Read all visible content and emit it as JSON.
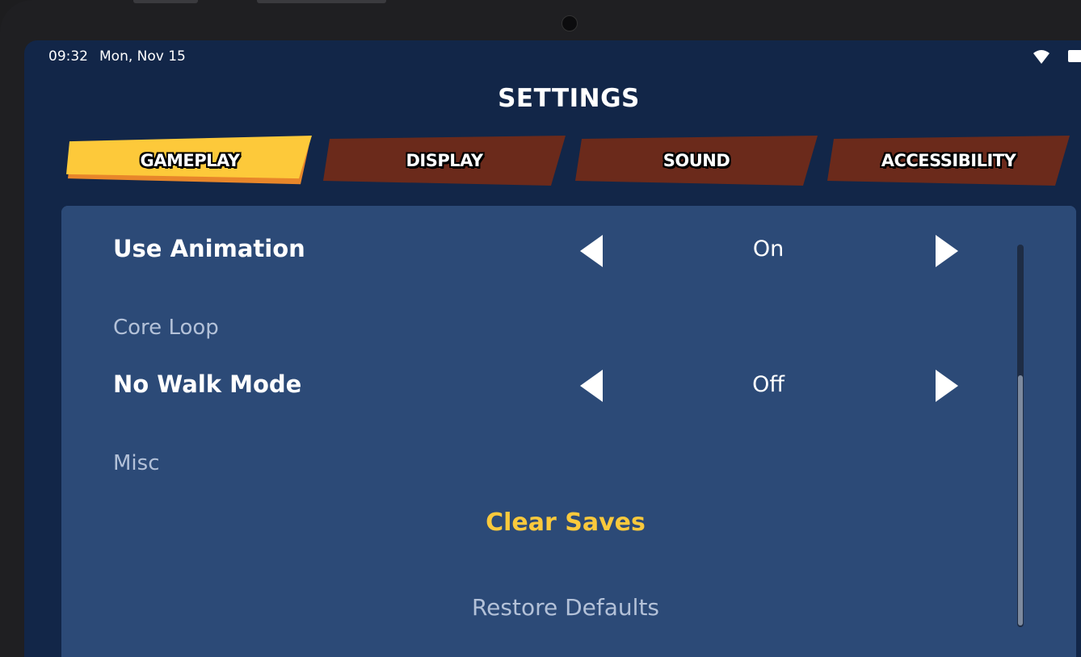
{
  "status_bar": {
    "time": "09:32",
    "date": "Mon, Nov 15"
  },
  "header": {
    "title": "SETTINGS"
  },
  "tabs": [
    {
      "label": "GAMEPLAY",
      "active": true
    },
    {
      "label": "DISPLAY",
      "active": false
    },
    {
      "label": "SOUND",
      "active": false
    },
    {
      "label": "ACCESSIBILITY",
      "active": false
    }
  ],
  "settings": {
    "use_animation": {
      "label": "Use Animation",
      "value": "On"
    },
    "core_loop_section": "Core Loop",
    "no_walk_mode": {
      "label": "No Walk Mode",
      "value": "Off"
    },
    "misc_section": "Misc",
    "clear_saves": "Clear Saves",
    "restore_defaults": "Restore Defaults"
  },
  "scroll_position": 0.34,
  "colors": {
    "active_tab": "#fdc93a",
    "inactive_tab": "#6b2a1b",
    "accent_text": "#f9c93c",
    "background": "#122648",
    "panel": "#2c4a77"
  },
  "icons": [
    "wifi-icon",
    "battery-icon",
    "arrow-left-icon",
    "arrow-right-icon"
  ]
}
